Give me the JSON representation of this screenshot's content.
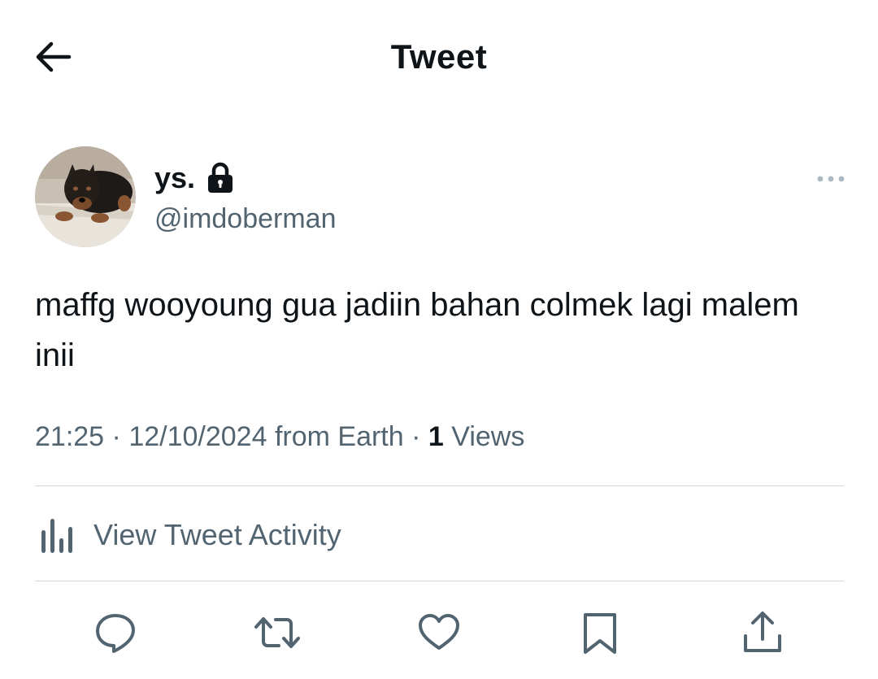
{
  "header": {
    "title": "Tweet"
  },
  "tweet": {
    "author": {
      "display_name": "ys.",
      "handle": "@imdoberman",
      "avatar": "doberman-puppy-photo",
      "protected_icon": "lock-icon"
    },
    "text": "maffg wooyoung gua jadiin bahan colmek lagi malem inii",
    "time": "21:25",
    "separator": "·",
    "date": "12/10/2024",
    "source": "from Earth",
    "views_count": "1",
    "views_label": "Views"
  },
  "activity": {
    "label": "View Tweet Activity",
    "icon": "analytics-icon"
  },
  "actions": [
    {
      "name": "reply",
      "icon": "reply-icon"
    },
    {
      "name": "retweet",
      "icon": "retweet-icon"
    },
    {
      "name": "like",
      "icon": "heart-icon"
    },
    {
      "name": "bookmark",
      "icon": "bookmark-icon"
    },
    {
      "name": "share",
      "icon": "share-icon"
    }
  ],
  "colors": {
    "text_primary": "#0f1419",
    "text_secondary": "#536471",
    "divider": "#cfd9de",
    "background": "#ffffff"
  }
}
